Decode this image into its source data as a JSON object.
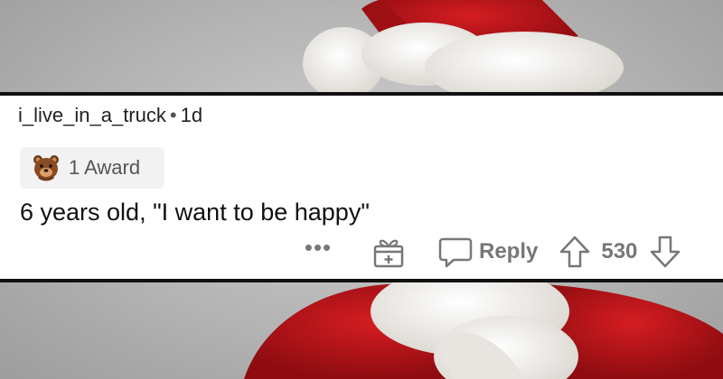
{
  "comment": {
    "username": "i_live_in_a_truck",
    "separator": "•",
    "age": "1d",
    "award_label": "1 Award",
    "body": "6 years old, \"I want to be happy\"",
    "more_label": "•••",
    "reply_label": "Reply",
    "score": "530"
  },
  "icons": {
    "award": "bear-award-icon",
    "gift": "gift-icon",
    "reply": "speech-bubble-icon",
    "upvote": "arrow-up-icon",
    "downvote": "arrow-down-icon"
  },
  "colors": {
    "santa_red": "#c0171c",
    "fur_white": "#f4f2ee",
    "meta_text": "#555555",
    "action_gray": "#777777",
    "backdrop_gray": "#b9b9b9"
  }
}
